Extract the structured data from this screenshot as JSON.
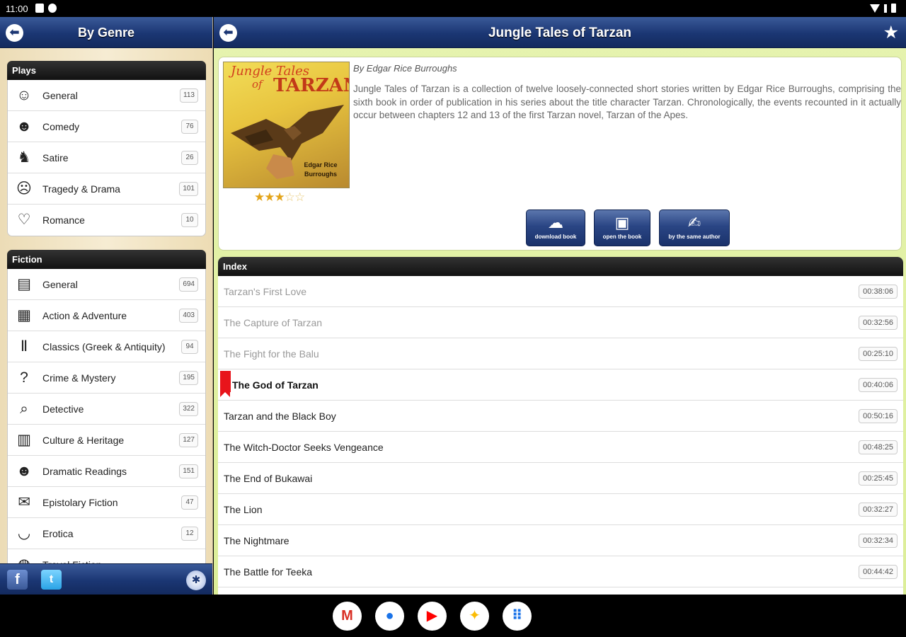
{
  "status_bar": {
    "time": "11:00"
  },
  "left_panel": {
    "title": "By Genre",
    "groups": [
      {
        "name": "Plays",
        "items": [
          {
            "label": "General",
            "count": "113",
            "icon": "theater-masks-icon"
          },
          {
            "label": "Comedy",
            "count": "76",
            "icon": "comedy-mask-icon"
          },
          {
            "label": "Satire",
            "count": "26",
            "icon": "jester-icon"
          },
          {
            "label": "Tragedy & Drama",
            "count": "101",
            "icon": "tragedy-mask-icon"
          },
          {
            "label": "Romance",
            "count": "10",
            "icon": "romance-couple-icon"
          }
        ]
      },
      {
        "name": "Fiction",
        "items": [
          {
            "label": "General",
            "count": "694",
            "icon": "book-icon"
          },
          {
            "label": "Action & Adventure",
            "count": "403",
            "icon": "map-icon"
          },
          {
            "label": "Classics (Greek & Antiquity)",
            "count": "94",
            "icon": "column-icon"
          },
          {
            "label": "Crime & Mystery",
            "count": "195",
            "icon": "question-mark-icon"
          },
          {
            "label": "Detective",
            "count": "322",
            "icon": "magnifier-icon"
          },
          {
            "label": "Culture & Heritage",
            "count": "127",
            "icon": "scroll-icon"
          },
          {
            "label": "Dramatic Readings",
            "count": "151",
            "icon": "masks-icon"
          },
          {
            "label": "Epistolary Fiction",
            "count": "47",
            "icon": "envelope-icon"
          },
          {
            "label": "Erotica",
            "count": "12",
            "icon": "lips-icon"
          },
          {
            "label": "Travel Fiction",
            "count": "",
            "icon": "globe-icon"
          }
        ]
      }
    ],
    "footer": {
      "facebook": "f",
      "twitter": "t"
    }
  },
  "book": {
    "title": "Jungle Tales of Tarzan",
    "author": "By Edgar Rice Burroughs",
    "description": "Jungle Tales of Tarzan is a collection of twelve loosely-connected short stories written by Edgar Rice Burroughs, comprising the sixth book in order of publication in his series about the title character Tarzan. Chronologically, the events recounted in it actually occur between chapters 12 and 13 of the first Tarzan novel, Tarzan of the Apes.",
    "cover": {
      "line1": "Jungle Tales",
      "line2": "of",
      "line3": "TARZAN",
      "author_line1": "Edgar Rice",
      "author_line2": "Burroughs"
    },
    "rating": 2.5,
    "rating_max": 5,
    "actions": [
      {
        "label": "download book",
        "icon": "cloud-download-icon"
      },
      {
        "label": "open the book",
        "icon": "open-book-icon"
      },
      {
        "label": "by the same author",
        "icon": "author-icon"
      }
    ]
  },
  "index": {
    "header": "Index",
    "chapters": [
      {
        "title": "Tarzan's First Love",
        "duration": "00:38:06",
        "state": "listened"
      },
      {
        "title": "The Capture of Tarzan",
        "duration": "00:32:56",
        "state": "listened"
      },
      {
        "title": "The Fight for the Balu",
        "duration": "00:25:10",
        "state": "listened"
      },
      {
        "title": "The God of Tarzan",
        "duration": "00:40:06",
        "state": "current"
      },
      {
        "title": "Tarzan and the Black Boy",
        "duration": "00:50:16",
        "state": "normal"
      },
      {
        "title": "The Witch-Doctor Seeks Vengeance",
        "duration": "00:48:25",
        "state": "normal"
      },
      {
        "title": "The End of Bukawai",
        "duration": "00:25:45",
        "state": "normal"
      },
      {
        "title": "The Lion",
        "duration": "00:32:27",
        "state": "normal"
      },
      {
        "title": "The Nightmare",
        "duration": "00:32:34",
        "state": "normal"
      },
      {
        "title": "The Battle for Teeka",
        "duration": "00:44:42",
        "state": "normal"
      }
    ]
  },
  "dock": [
    {
      "name": "gmail-icon",
      "glyph": "M",
      "color": "#d93025"
    },
    {
      "name": "chrome-icon",
      "glyph": "●",
      "color": "#1a73e8"
    },
    {
      "name": "youtube-icon",
      "glyph": "▶",
      "color": "#ff0000"
    },
    {
      "name": "photos-icon",
      "glyph": "✦",
      "color": "#fbbc04"
    },
    {
      "name": "app-drawer-icon",
      "glyph": "⠿",
      "color": "#1a73e8"
    }
  ],
  "colors": {
    "navbar": "#1b3673",
    "accent_green": "#dcee98",
    "bookmark": "#e8141b",
    "star": "#e3a41a"
  }
}
